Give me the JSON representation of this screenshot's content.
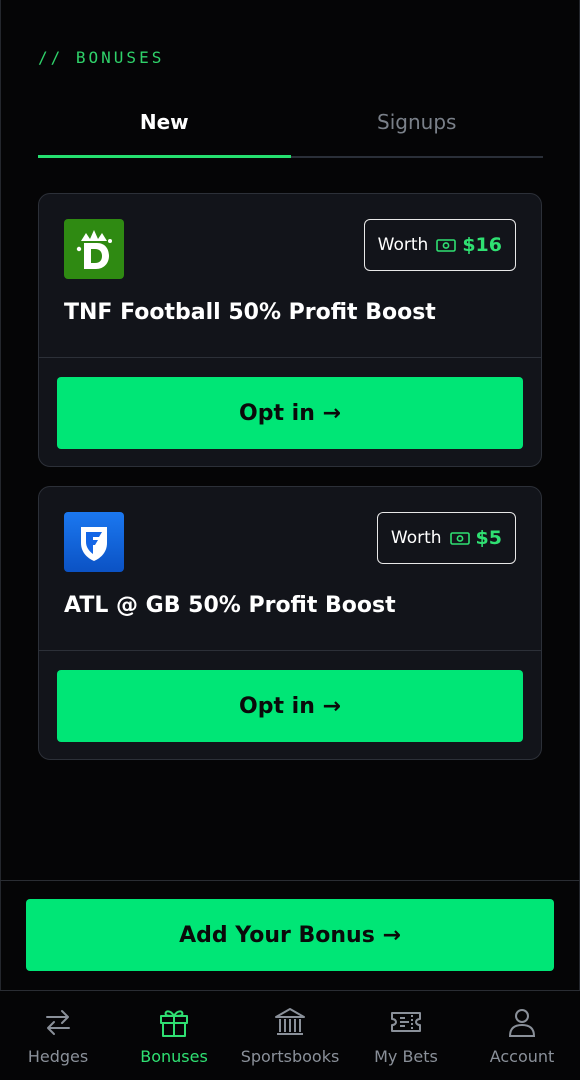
{
  "section_label": "// BONUSES",
  "tabs": [
    {
      "label": "New",
      "active": true
    },
    {
      "label": "Signups",
      "active": false
    }
  ],
  "bonuses": [
    {
      "book_icon": "draftkings-logo-icon",
      "worth_label": "Worth",
      "worth_amount": "$16",
      "title": "TNF Football 50% Profit Boost",
      "button_label": "Opt in →"
    },
    {
      "book_icon": "fanduel-logo-icon",
      "worth_label": "Worth",
      "worth_amount": "$5",
      "title": "ATL @ GB 50% Profit Boost",
      "button_label": "Opt in →"
    }
  ],
  "add_bonus_label": "Add Your Bonus →",
  "nav": [
    {
      "label": "Hedges",
      "icon": "arrows-swap-icon",
      "active": false
    },
    {
      "label": "Bonuses",
      "icon": "gift-icon",
      "active": true
    },
    {
      "label": "Sportsbooks",
      "icon": "bank-icon",
      "active": false
    },
    {
      "label": "My Bets",
      "icon": "ticket-icon",
      "active": false
    },
    {
      "label": "Account",
      "icon": "user-icon",
      "active": false
    }
  ],
  "colors": {
    "accent": "#00e676",
    "background": "#050506",
    "card": "#12141a",
    "draftkings_green": "#2f8a12",
    "fanduel_blue": "#1466e6"
  }
}
